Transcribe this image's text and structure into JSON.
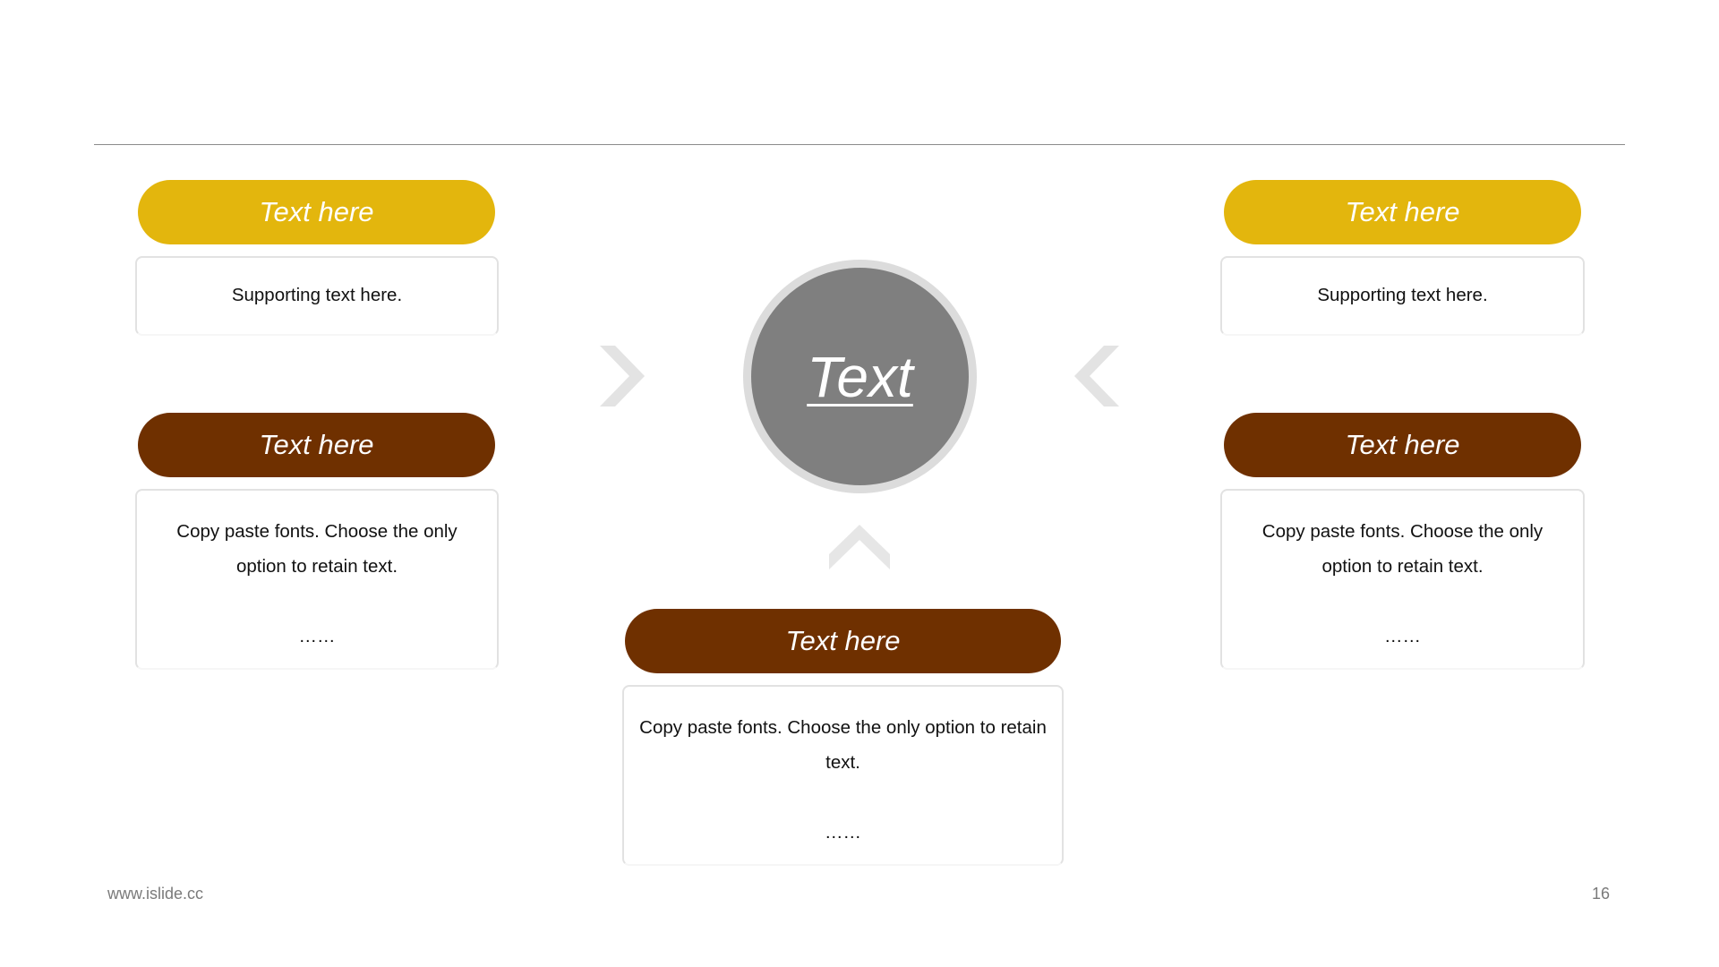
{
  "slide": {
    "page_number": "16",
    "footer_url": "www.islide.cc",
    "colors": {
      "accent_yellow": "#e3b60d",
      "accent_brown": "#6f3000",
      "center_gray": "#7f7f7f",
      "ring_gray": "#dcdcdc",
      "chevron_gray": "#e3e3e3"
    }
  },
  "center": {
    "label": "Text"
  },
  "blocks": {
    "top_left": {
      "title": "Text here",
      "body": "Supporting text here.",
      "color": "yellow"
    },
    "top_right": {
      "title": "Text here",
      "body": "Supporting text here.",
      "color": "yellow"
    },
    "mid_left": {
      "title": "Text here",
      "body_line1": "Copy paste fonts. Choose the only",
      "body_line2": "option to retain text.",
      "ellipsis": "……",
      "color": "brown"
    },
    "mid_right": {
      "title": "Text here",
      "body_line1": "Copy paste fonts. Choose the only",
      "body_line2": "option to retain text.",
      "ellipsis": "……",
      "color": "brown"
    },
    "bottom": {
      "title": "Text here",
      "body_line1": "Copy paste fonts. Choose the only option to retain",
      "body_line2": "text.",
      "ellipsis": "……",
      "color": "brown"
    }
  },
  "icons": {
    "left_arrow": "chevron-right-icon",
    "right_arrow": "chevron-left-icon",
    "bottom_arrow": "chevron-up-icon"
  }
}
